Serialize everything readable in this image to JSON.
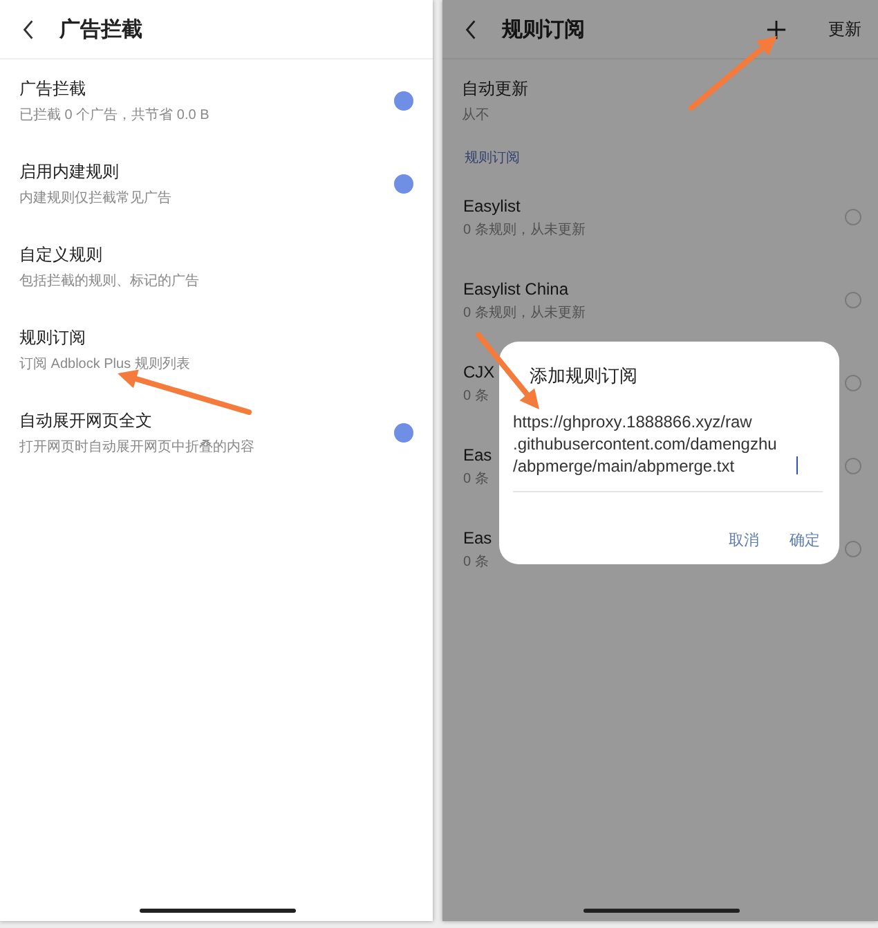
{
  "left_screen": {
    "title": "广告拦截",
    "items": [
      {
        "kind": "toggle",
        "title": "广告拦截",
        "subtitle": "已拦截 0 个广告，共节省 0.0 B",
        "on": true
      },
      {
        "kind": "toggle",
        "title": "启用内建规则",
        "subtitle": "内建规则仅拦截常见广告",
        "on": true
      },
      {
        "kind": "link",
        "title": "自定义规则",
        "subtitle": "包括拦截的规则、标记的广告"
      },
      {
        "kind": "link",
        "title": "规则订阅",
        "subtitle": "订阅 Adblock Plus 规则列表"
      },
      {
        "kind": "toggle",
        "title": "自动展开网页全文",
        "subtitle": "打开网页时自动展开网页中折叠的内容",
        "on": true
      }
    ]
  },
  "right_screen": {
    "title": "规则订阅",
    "action": "更新",
    "auto_update": {
      "title": "自动更新",
      "value": "从不"
    },
    "section": "规则订阅",
    "subscriptions": [
      {
        "title": "Easylist",
        "subtitle": "0 条规则，从未更新",
        "checked": false
      },
      {
        "title": "Easylist China",
        "subtitle": "0 条规则，从未更新",
        "checked": false
      },
      {
        "title": "CJX",
        "subtitle": "0 条",
        "checked": false
      },
      {
        "title": "Eas",
        "subtitle": "0 条",
        "checked": false
      },
      {
        "title": "Eas",
        "subtitle": "0 条",
        "checked": false
      }
    ]
  },
  "dialog": {
    "title": "添加规则订阅",
    "value": "https://ghproxy.1888866.xyz/raw.githubusercontent.com/damengzhu/abpmerge/main/abpmerge.txt",
    "buttons": [
      "取消",
      "确定"
    ]
  }
}
